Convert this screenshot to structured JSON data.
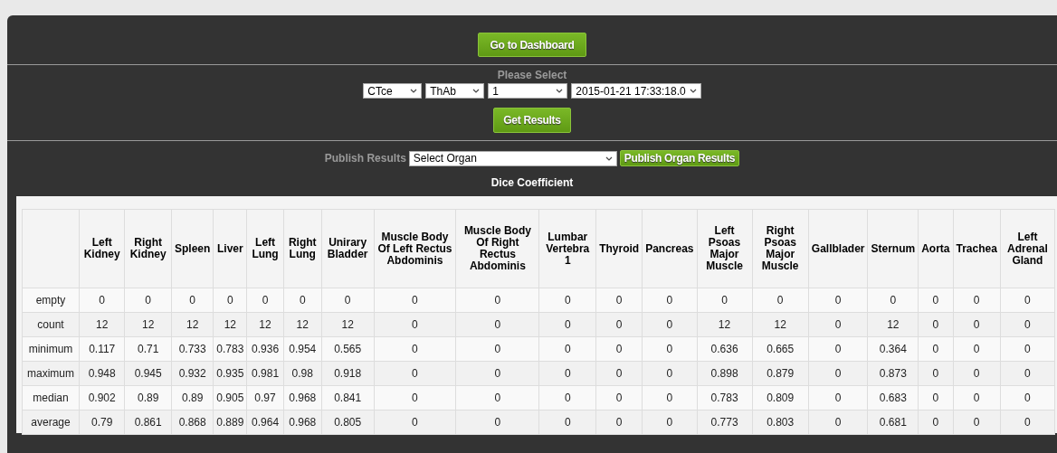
{
  "dashboard_button": "Go to Dashboard",
  "select_heading": "Please Select",
  "selects": [
    {
      "value": "CTce"
    },
    {
      "value": "ThAb"
    },
    {
      "value": "1"
    },
    {
      "value": "2015-01-21 17:33:18.0"
    }
  ],
  "get_results_button": "Get Results",
  "publish": {
    "label": "Publish Results",
    "select": "Select Organ",
    "button": "Publish Organ Results"
  },
  "table_title": "Dice Coefficient",
  "table": {
    "columns": [
      "Left Kidney",
      "Right Kidney",
      "Spleen",
      "Liver",
      "Left Lung",
      "Right Lung",
      "Unirary Bladder",
      "Muscle Body Of Left Rectus Abdominis",
      "Muscle Body Of Right Rectus Abdominis",
      "Lumbar Vertebra 1",
      "Thyroid",
      "Pancreas",
      "Left Psoas Major Muscle",
      "Right Psoas Major Muscle",
      "Gallblader",
      "Sternum",
      "Aorta",
      "Trachea",
      "Left Adrenal Gland"
    ],
    "rows": [
      {
        "label": "empty",
        "values": [
          "0",
          "0",
          "0",
          "0",
          "0",
          "0",
          "0",
          "0",
          "0",
          "0",
          "0",
          "0",
          "0",
          "0",
          "0",
          "0",
          "0",
          "0",
          "0"
        ]
      },
      {
        "label": "count",
        "values": [
          "12",
          "12",
          "12",
          "12",
          "12",
          "12",
          "12",
          "0",
          "0",
          "0",
          "0",
          "0",
          "12",
          "12",
          "0",
          "12",
          "0",
          "0",
          "0"
        ]
      },
      {
        "label": "minimum",
        "values": [
          "0.117",
          "0.71",
          "0.733",
          "0.783",
          "0.936",
          "0.954",
          "0.565",
          "0",
          "0",
          "0",
          "0",
          "0",
          "0.636",
          "0.665",
          "0",
          "0.364",
          "0",
          "0",
          "0"
        ]
      },
      {
        "label": "maximum",
        "values": [
          "0.948",
          "0.945",
          "0.932",
          "0.935",
          "0.981",
          "0.98",
          "0.918",
          "0",
          "0",
          "0",
          "0",
          "0",
          "0.898",
          "0.879",
          "0",
          "0.873",
          "0",
          "0",
          "0"
        ]
      },
      {
        "label": "median",
        "values": [
          "0.902",
          "0.89",
          "0.89",
          "0.905",
          "0.97",
          "0.968",
          "0.841",
          "0",
          "0",
          "0",
          "0",
          "0",
          "0.783",
          "0.809",
          "0",
          "0.683",
          "0",
          "0",
          "0"
        ]
      },
      {
        "label": "average",
        "values": [
          "0.79",
          "0.861",
          "0.868",
          "0.889",
          "0.964",
          "0.968",
          "0.805",
          "0",
          "0",
          "0",
          "0",
          "0",
          "0.773",
          "0.803",
          "0",
          "0.681",
          "0",
          "0",
          "0"
        ]
      }
    ]
  }
}
